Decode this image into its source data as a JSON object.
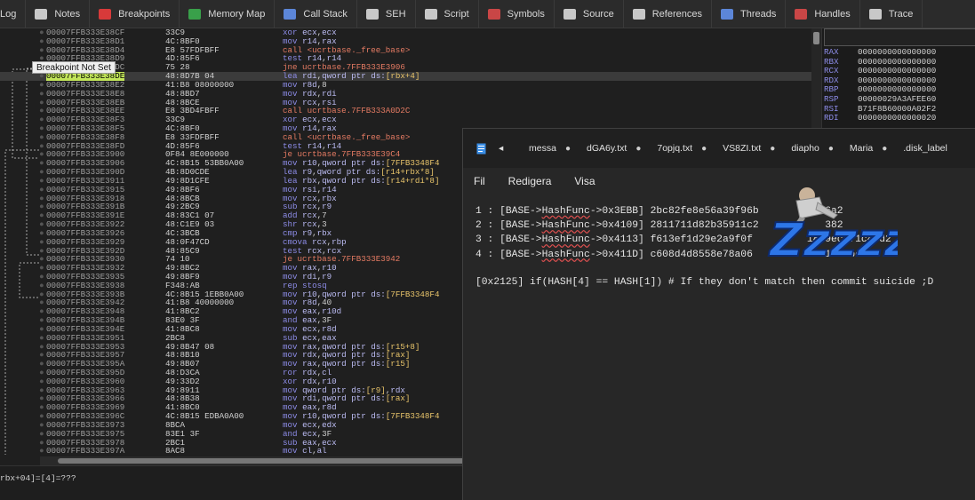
{
  "tabs": [
    {
      "label": "Log",
      "icon": "log-icon",
      "color": "#9aa"
    },
    {
      "label": "Notes",
      "icon": "notes-icon",
      "color": "#c9c9c9"
    },
    {
      "label": "Breakpoints",
      "icon": "breakpoints-icon",
      "color": "#d83a3a"
    },
    {
      "label": "Memory Map",
      "icon": "memory-map-icon",
      "color": "#39a04a"
    },
    {
      "label": "Call Stack",
      "icon": "call-stack-icon",
      "color": "#5c86d8"
    },
    {
      "label": "SEH",
      "icon": "seh-icon",
      "color": "#c8c8c8"
    },
    {
      "label": "Script",
      "icon": "script-icon",
      "color": "#c8c8c8"
    },
    {
      "label": "Symbols",
      "icon": "symbols-icon",
      "color": "#c94646"
    },
    {
      "label": "Source",
      "icon": "source-icon",
      "color": "#c8c8c8"
    },
    {
      "label": "References",
      "icon": "references-icon",
      "color": "#c8c8c8"
    },
    {
      "label": "Threads",
      "icon": "threads-icon",
      "color": "#5c86d8"
    },
    {
      "label": "Handles",
      "icon": "handles-icon",
      "color": "#c94646"
    },
    {
      "label": "Trace",
      "icon": "trace-icon",
      "color": "#c8c8c8"
    }
  ],
  "tooltip": "Breakpoint Not Set",
  "disasm": [
    {
      "a": "00007FFB333E38CF",
      "b": "33C9",
      "i": [
        [
          "m",
          "xor "
        ],
        [
          "r",
          "ecx"
        ],
        [
          "n",
          ","
        ],
        [
          "r",
          "ecx"
        ]
      ]
    },
    {
      "a": "00007FFB333E38D1",
      "b": "4C:8BF0",
      "i": [
        [
          "m",
          "mov "
        ],
        [
          "r",
          "r14"
        ],
        [
          "n",
          ","
        ],
        [
          "r",
          "rax"
        ]
      ]
    },
    {
      "a": "00007FFB333E38D4",
      "b": "E8 57FDFBFF",
      "i": [
        [
          "c",
          "call <ucrtbase._free_base>"
        ]
      ]
    },
    {
      "a": "00007FFB333E38D9",
      "b": "4D:85F6",
      "i": [
        [
          "m",
          "test "
        ],
        [
          "r",
          "r14"
        ],
        [
          "n",
          ","
        ],
        [
          "r",
          "r14"
        ]
      ]
    },
    {
      "a": "00007FFB333E38DC",
      "b": "75 28",
      "i": [
        [
          "j",
          "jne ucrtbase.7FFB333E3906"
        ]
      ]
    },
    {
      "a": "00007FFB333E38DE",
      "b": "48:8D7B 04",
      "i": [
        [
          "m",
          "lea "
        ],
        [
          "r",
          "rdi"
        ],
        [
          "n",
          ","
        ],
        [
          "r",
          "qword ptr ds:"
        ],
        [
          "s",
          "[rbx+4]"
        ]
      ],
      "sel": true
    },
    {
      "a": "00007FFB333E38E2",
      "b": "41:B8 08000000",
      "i": [
        [
          "m",
          "mov "
        ],
        [
          "r",
          "r8d"
        ],
        [
          "n",
          ","
        ],
        [
          "n",
          "8"
        ]
      ]
    },
    {
      "a": "00007FFB333E38E8",
      "b": "48:8BD7",
      "i": [
        [
          "m",
          "mov "
        ],
        [
          "r",
          "rdx"
        ],
        [
          "n",
          ","
        ],
        [
          "r",
          "rdi"
        ]
      ]
    },
    {
      "a": "00007FFB333E38EB",
      "b": "48:8BCE",
      "i": [
        [
          "m",
          "mov "
        ],
        [
          "r",
          "rcx"
        ],
        [
          "n",
          ","
        ],
        [
          "r",
          "rsi"
        ]
      ]
    },
    {
      "a": "00007FFB333E38EE",
      "b": "E8 3BD4FBFF",
      "i": [
        [
          "c",
          "call ucrtbase.7FFB333A0D2C"
        ]
      ]
    },
    {
      "a": "00007FFB333E38F3",
      "b": "33C9",
      "i": [
        [
          "m",
          "xor "
        ],
        [
          "r",
          "ecx"
        ],
        [
          "n",
          ","
        ],
        [
          "r",
          "ecx"
        ]
      ]
    },
    {
      "a": "00007FFB333E38F5",
      "b": "4C:8BF0",
      "i": [
        [
          "m",
          "mov "
        ],
        [
          "r",
          "r14"
        ],
        [
          "n",
          ","
        ],
        [
          "r",
          "rax"
        ]
      ]
    },
    {
      "a": "00007FFB333E38F8",
      "b": "E8 33FDFBFF",
      "i": [
        [
          "c",
          "call <ucrtbase._free_base>"
        ]
      ]
    },
    {
      "a": "00007FFB333E38FD",
      "b": "4D:85F6",
      "i": [
        [
          "m",
          "test "
        ],
        [
          "r",
          "r14"
        ],
        [
          "n",
          ","
        ],
        [
          "r",
          "r14"
        ]
      ]
    },
    {
      "a": "00007FFB333E3900",
      "b": "0F84 8E000000",
      "i": [
        [
          "j",
          "je ucrtbase.7FFB333E39C4"
        ]
      ]
    },
    {
      "a": "00007FFB333E3906",
      "b": "4C:8B15 53BB0A00",
      "i": [
        [
          "m",
          "mov "
        ],
        [
          "r",
          "r10"
        ],
        [
          "n",
          ","
        ],
        [
          "r",
          "qword ptr ds:"
        ],
        [
          "s",
          "[7FFB3348F4"
        ]
      ]
    },
    {
      "a": "00007FFB333E390D",
      "b": "4B:8D0CDE",
      "i": [
        [
          "m",
          "lea "
        ],
        [
          "r",
          "r9"
        ],
        [
          "n",
          ","
        ],
        [
          "r",
          "qword ptr ds:"
        ],
        [
          "s",
          "[r14+rbx*8]"
        ]
      ]
    },
    {
      "a": "00007FFB333E3911",
      "b": "49:8D1CFE",
      "i": [
        [
          "m",
          "lea "
        ],
        [
          "r",
          "rbx"
        ],
        [
          "n",
          ","
        ],
        [
          "r",
          "qword ptr ds:"
        ],
        [
          "s",
          "[r14+rdi*8]"
        ]
      ]
    },
    {
      "a": "00007FFB333E3915",
      "b": "49:8BF6",
      "i": [
        [
          "m",
          "mov "
        ],
        [
          "r",
          "rsi"
        ],
        [
          "n",
          ","
        ],
        [
          "r",
          "r14"
        ]
      ]
    },
    {
      "a": "00007FFB333E3918",
      "b": "48:8BCB",
      "i": [
        [
          "m",
          "mov "
        ],
        [
          "r",
          "rcx"
        ],
        [
          "n",
          ","
        ],
        [
          "r",
          "rbx"
        ]
      ]
    },
    {
      "a": "00007FFB333E391B",
      "b": "49:2BC9",
      "i": [
        [
          "m",
          "sub "
        ],
        [
          "r",
          "rcx"
        ],
        [
          "n",
          ","
        ],
        [
          "r",
          "r9"
        ]
      ]
    },
    {
      "a": "00007FFB333E391E",
      "b": "48:83C1 07",
      "i": [
        [
          "m",
          "add "
        ],
        [
          "r",
          "rcx"
        ],
        [
          "n",
          ","
        ],
        [
          "n",
          "7"
        ]
      ]
    },
    {
      "a": "00007FFB333E3922",
      "b": "48:C1E9 03",
      "i": [
        [
          "m",
          "shr "
        ],
        [
          "r",
          "rcx"
        ],
        [
          "n",
          ","
        ],
        [
          "n",
          "3"
        ]
      ]
    },
    {
      "a": "00007FFB333E3926",
      "b": "4C:3BCB",
      "i": [
        [
          "m",
          "cmp "
        ],
        [
          "r",
          "r9"
        ],
        [
          "n",
          ","
        ],
        [
          "r",
          "rbx"
        ]
      ]
    },
    {
      "a": "00007FFB333E3929",
      "b": "48:0F47CD",
      "i": [
        [
          "m",
          "cmova "
        ],
        [
          "r",
          "rcx"
        ],
        [
          "n",
          ","
        ],
        [
          "r",
          "rbp"
        ]
      ]
    },
    {
      "a": "00007FFB333E392D",
      "b": "48:85C9",
      "i": [
        [
          "m",
          "test "
        ],
        [
          "r",
          "rcx"
        ],
        [
          "n",
          ","
        ],
        [
          "r",
          "rcx"
        ]
      ]
    },
    {
      "a": "00007FFB333E3930",
      "b": "74 10",
      "i": [
        [
          "j",
          "je ucrtbase.7FFB333E3942"
        ]
      ]
    },
    {
      "a": "00007FFB333E3932",
      "b": "49:8BC2",
      "i": [
        [
          "m",
          "mov "
        ],
        [
          "r",
          "rax"
        ],
        [
          "n",
          ","
        ],
        [
          "r",
          "r10"
        ]
      ]
    },
    {
      "a": "00007FFB333E3935",
      "b": "49:8BF9",
      "i": [
        [
          "m",
          "mov "
        ],
        [
          "r",
          "rdi"
        ],
        [
          "n",
          ","
        ],
        [
          "r",
          "r9"
        ]
      ]
    },
    {
      "a": "00007FFB333E3938",
      "b": "F348:AB",
      "i": [
        [
          "m",
          "rep stosq"
        ]
      ]
    },
    {
      "a": "00007FFB333E393B",
      "b": "4C:8B15 1EBB0A00",
      "i": [
        [
          "m",
          "mov "
        ],
        [
          "r",
          "r10"
        ],
        [
          "n",
          ","
        ],
        [
          "r",
          "qword ptr ds:"
        ],
        [
          "s",
          "[7FFB3348F4"
        ]
      ]
    },
    {
      "a": "00007FFB333E3942",
      "b": "41:B8 40000000",
      "i": [
        [
          "m",
          "mov "
        ],
        [
          "r",
          "r8d"
        ],
        [
          "n",
          ","
        ],
        [
          "n",
          "40"
        ]
      ]
    },
    {
      "a": "00007FFB333E3948",
      "b": "41:8BC2",
      "i": [
        [
          "m",
          "mov "
        ],
        [
          "r",
          "eax"
        ],
        [
          "n",
          ","
        ],
        [
          "r",
          "r10d"
        ]
      ]
    },
    {
      "a": "00007FFB333E394B",
      "b": "83E0 3F",
      "i": [
        [
          "m",
          "and "
        ],
        [
          "r",
          "eax"
        ],
        [
          "n",
          ","
        ],
        [
          "n",
          "3F"
        ]
      ]
    },
    {
      "a": "00007FFB333E394E",
      "b": "41:8BC8",
      "i": [
        [
          "m",
          "mov "
        ],
        [
          "r",
          "ecx"
        ],
        [
          "n",
          ","
        ],
        [
          "r",
          "r8d"
        ]
      ]
    },
    {
      "a": "00007FFB333E3951",
      "b": "2BC8",
      "i": [
        [
          "m",
          "sub "
        ],
        [
          "r",
          "ecx"
        ],
        [
          "n",
          ","
        ],
        [
          "r",
          "eax"
        ]
      ]
    },
    {
      "a": "00007FFB333E3953",
      "b": "49:8B47 08",
      "i": [
        [
          "m",
          "mov "
        ],
        [
          "r",
          "rax"
        ],
        [
          "n",
          ","
        ],
        [
          "r",
          "qword ptr ds:"
        ],
        [
          "s",
          "[r15+8]"
        ]
      ]
    },
    {
      "a": "00007FFB333E3957",
      "b": "48:8B10",
      "i": [
        [
          "m",
          "mov "
        ],
        [
          "r",
          "rdx"
        ],
        [
          "n",
          ","
        ],
        [
          "r",
          "qword ptr ds:"
        ],
        [
          "s",
          "[rax]"
        ]
      ]
    },
    {
      "a": "00007FFB333E395A",
      "b": "49:8B07",
      "i": [
        [
          "m",
          "mov "
        ],
        [
          "r",
          "rax"
        ],
        [
          "n",
          ","
        ],
        [
          "r",
          "qword ptr ds:"
        ],
        [
          "s",
          "[r15]"
        ]
      ]
    },
    {
      "a": "00007FFB333E395D",
      "b": "48:D3CA",
      "i": [
        [
          "m",
          "ror "
        ],
        [
          "r",
          "rdx"
        ],
        [
          "n",
          ","
        ],
        [
          "r",
          "cl"
        ]
      ]
    },
    {
      "a": "00007FFB333E3960",
      "b": "49:33D2",
      "i": [
        [
          "m",
          "xor "
        ],
        [
          "r",
          "rdx"
        ],
        [
          "n",
          ","
        ],
        [
          "r",
          "r10"
        ]
      ]
    },
    {
      "a": "00007FFB333E3963",
      "b": "49:8911",
      "i": [
        [
          "m",
          "mov "
        ],
        [
          "r",
          "qword ptr ds:"
        ],
        [
          "s",
          "[r9]"
        ],
        [
          "n",
          ","
        ],
        [
          "r",
          "rdx"
        ]
      ]
    },
    {
      "a": "00007FFB333E3966",
      "b": "48:8B38",
      "i": [
        [
          "m",
          "mov "
        ],
        [
          "r",
          "rdi"
        ],
        [
          "n",
          ","
        ],
        [
          "r",
          "qword ptr ds:"
        ],
        [
          "s",
          "[rax]"
        ]
      ]
    },
    {
      "a": "00007FFB333E3969",
      "b": "41:8BC0",
      "i": [
        [
          "m",
          "mov "
        ],
        [
          "r",
          "eax"
        ],
        [
          "n",
          ","
        ],
        [
          "r",
          "r8d"
        ]
      ]
    },
    {
      "a": "00007FFB333E396C",
      "b": "4C:8B15 EDBA0A00",
      "i": [
        [
          "m",
          "mov "
        ],
        [
          "r",
          "r10"
        ],
        [
          "n",
          ","
        ],
        [
          "r",
          "qword ptr ds:"
        ],
        [
          "s",
          "[7FFB3348F4"
        ]
      ]
    },
    {
      "a": "00007FFB333E3973",
      "b": "8BCA",
      "i": [
        [
          "m",
          "mov "
        ],
        [
          "r",
          "ecx"
        ],
        [
          "n",
          ","
        ],
        [
          "r",
          "edx"
        ]
      ]
    },
    {
      "a": "00007FFB333E3975",
      "b": "83E1 3F",
      "i": [
        [
          "m",
          "and "
        ],
        [
          "r",
          "ecx"
        ],
        [
          "n",
          ","
        ],
        [
          "n",
          "3F"
        ]
      ]
    },
    {
      "a": "00007FFB333E3978",
      "b": "2BC1",
      "i": [
        [
          "m",
          "sub "
        ],
        [
          "r",
          "eax"
        ],
        [
          "n",
          ","
        ],
        [
          "r",
          "ecx"
        ]
      ]
    },
    {
      "a": "00007FFB333E397A",
      "b": "8AC8",
      "i": [
        [
          "m",
          "mov "
        ],
        [
          "r",
          "cl"
        ],
        [
          "n",
          ","
        ],
        [
          "r",
          "al"
        ]
      ]
    }
  ],
  "registers": [
    {
      "n": "RAX",
      "v": "0000000000000000"
    },
    {
      "n": "RBX",
      "v": "0000000000000000"
    },
    {
      "n": "RCX",
      "v": "0000000000000000"
    },
    {
      "n": "RDX",
      "v": "0000000000000000"
    },
    {
      "n": "RBP",
      "v": "0000000000000000"
    },
    {
      "n": "RSP",
      "v": "00000029A3AFEE60"
    },
    {
      "n": "RSI",
      "v": "B71F8B60000A02F2"
    },
    {
      "n": "RDI",
      "v": "0000000000000020"
    }
  ],
  "bottom": {
    "line1": "rbx+04]=[4]=???",
    "line2": "                     "
  },
  "notepad": {
    "tabs": [
      {
        "label": "",
        "icon": "file-icon"
      },
      {
        "label": "",
        "icon": "chevron-left-icon"
      },
      {
        "label": "messa"
      },
      {
        "label": "dGA6y.txt"
      },
      {
        "label": "7opjq.txt"
      },
      {
        "label": "VS8ZI.txt"
      },
      {
        "label": "diapho"
      },
      {
        "label": "Maria"
      },
      {
        "label": ".disk_label"
      }
    ],
    "menu": [
      "Fil",
      "Redigera",
      "Visa"
    ],
    "lines": [
      {
        "pre": "1 : [BASE->",
        "fn": "HashFunc",
        "post": "->0x3EBB] 2bc82fe8e56a39f96b           6a2"
      },
      {
        "pre": "2 : [BASE->",
        "fn": "HashFunc",
        "post": "->0x4109] 2811711d82b35911c2           382"
      },
      {
        "pre": "3 : [BASE->",
        "fn": "HashFunc",
        "post": "->0x4113] f613ef1d29e2a9f0f         1869ecc71c43d2"
      },
      {
        "pre": "4 : [BASE->",
        "fn": "HashFunc",
        "post": "->0x411D] c608d4d8558e78a06          011496bea"
      }
    ],
    "note": "[0x2125] if(HASH[4] == HASH[1]) # If they don't match then commit suicide ;D"
  },
  "sticker": "Zzzzz"
}
